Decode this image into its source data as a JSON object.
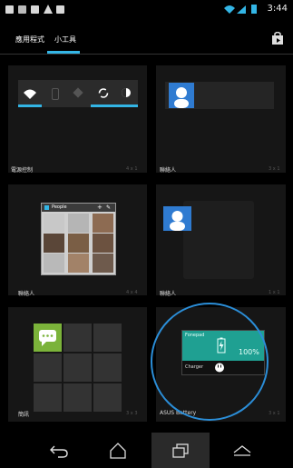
{
  "status_bar": {
    "time": "3:44",
    "icons": [
      "image-icon",
      "gallery-icon",
      "mail-icon",
      "warning-icon",
      "media-icon"
    ],
    "accent": "#33b5e5"
  },
  "tabs": [
    {
      "label": "應用程式",
      "selected": false
    },
    {
      "label": "小工具",
      "selected": true
    }
  ],
  "widgets": [
    {
      "label": "電源控制",
      "size": "4 x 1"
    },
    {
      "label": "聯絡人",
      "size": "3 x 1"
    },
    {
      "label": "聯絡人",
      "size": "4 x 4"
    },
    {
      "label": "聯絡人",
      "size": "1 x 1"
    },
    {
      "label": "簡訊",
      "size": "3 x 3"
    },
    {
      "label": "ASUS Battery",
      "size": "3 x 1"
    }
  ],
  "people_widget": {
    "title": "People"
  },
  "battery_widget": {
    "device": "Fonepad",
    "level": "100%",
    "charger_label": "Charger"
  },
  "nav": {
    "buttons": [
      "back-icon",
      "home-icon",
      "recent-apps-icon",
      "menu-up-icon"
    ]
  }
}
